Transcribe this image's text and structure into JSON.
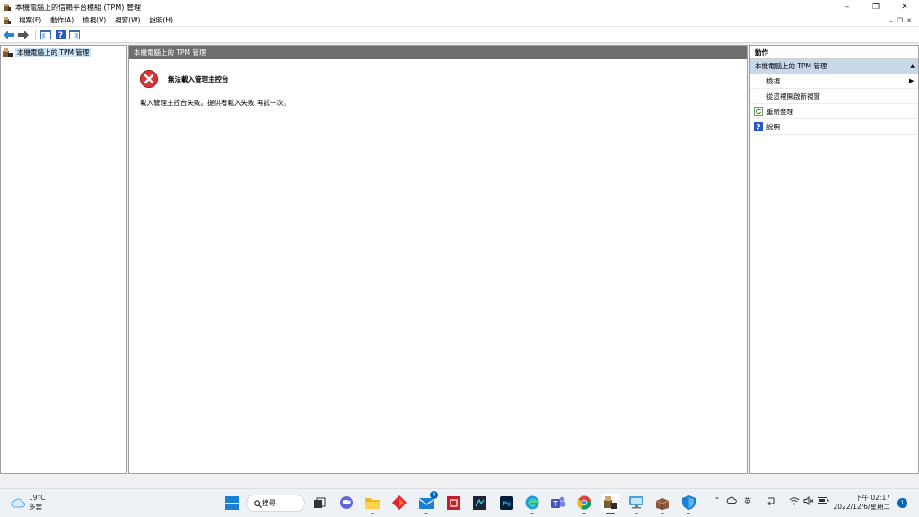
{
  "window": {
    "title": "本機電腦上的信賴平台模組 (TPM) 管理"
  },
  "menubar": {
    "items": [
      "檔案(F)",
      "動作(A)",
      "檢視(V)",
      "視窗(W)",
      "說明(H)"
    ]
  },
  "tree": {
    "root_label": "本機電腦上的 TPM 管理"
  },
  "center": {
    "header": "本機電腦上的 TPM 管理",
    "error_title": "無法載入管理主控台",
    "error_message": "載入管理主控台失敗。提供者載入失敗 再試一次。"
  },
  "actions": {
    "header": "動作",
    "group_label": "本機電腦上的 TPM 管理",
    "items": [
      {
        "label": "檢視",
        "icon": "none",
        "has_submenu": true
      },
      {
        "label": "從這裡開啟新視窗",
        "icon": "none",
        "has_submenu": false
      },
      {
        "label": "重新整理",
        "icon": "refresh-icon",
        "has_submenu": false
      },
      {
        "label": "說明",
        "icon": "help-icon",
        "has_submenu": false
      }
    ]
  },
  "taskbar": {
    "weather_temp": "19°C",
    "weather_desc": "多雲",
    "search_label": "搜尋",
    "mail_badge": "4",
    "ime_label": "英",
    "time": "下午 02:17",
    "date": "2022/12/6/星期二",
    "notification_count": "1"
  },
  "colors": {
    "accent": "#0067c0",
    "header_bar": "#6e6e6e",
    "selection": "#cce4f7",
    "action_group": "#c7d7ec",
    "error_red": "#d9343a"
  }
}
